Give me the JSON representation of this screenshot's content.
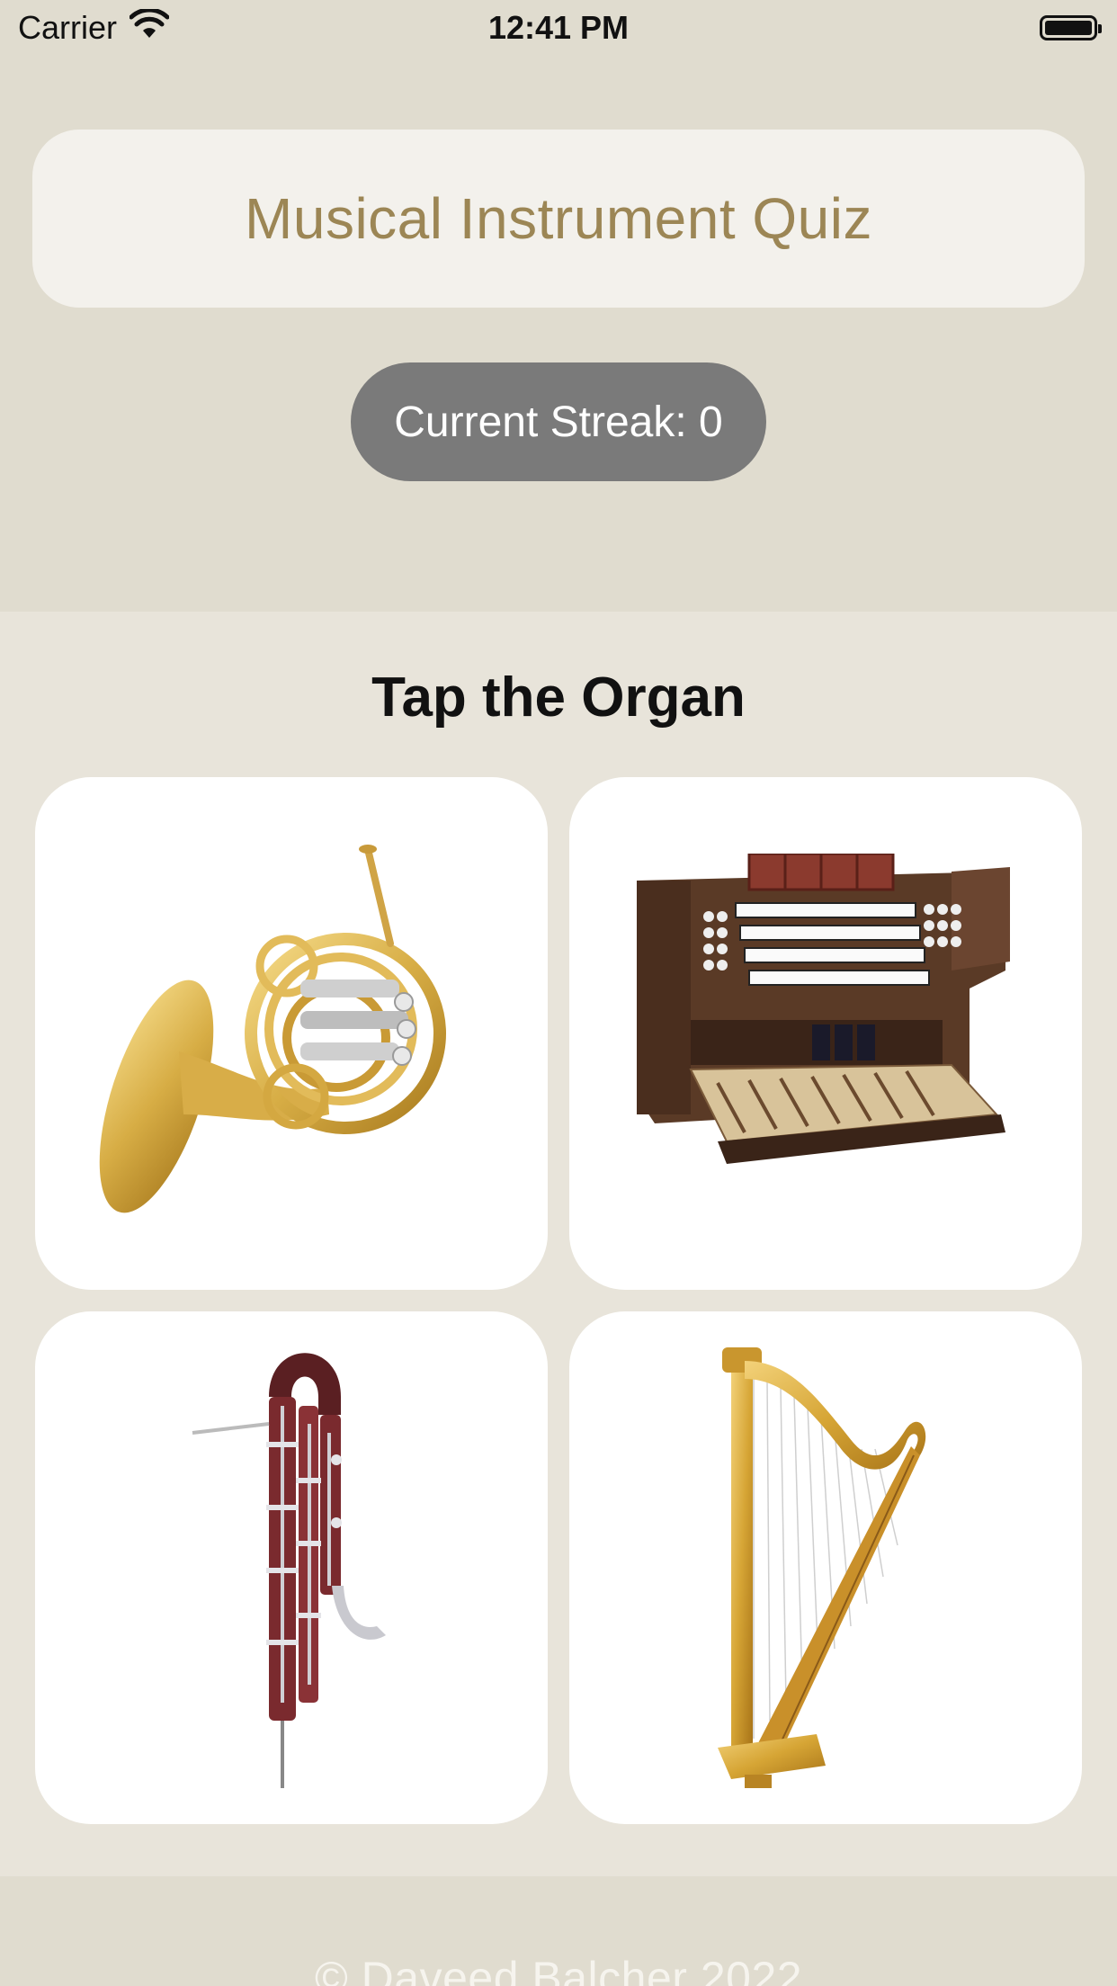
{
  "status_bar": {
    "carrier": "Carrier",
    "time": "12:41 PM"
  },
  "header": {
    "title": "Musical Instrument Quiz"
  },
  "streak": {
    "label": "Current Streak: 0"
  },
  "quiz": {
    "prompt": "Tap the Organ",
    "choices": [
      {
        "instrument": "french-horn"
      },
      {
        "instrument": "organ"
      },
      {
        "instrument": "contrabassoon"
      },
      {
        "instrument": "harp"
      }
    ]
  },
  "footer": {
    "copyright": "© Daveed Balcher 2022"
  },
  "colors": {
    "background": "#e0dccf",
    "quiz_background": "#e8e4da",
    "title_text": "#9c8655",
    "streak_badge": "#7a7a7a",
    "card": "#ffffff"
  }
}
